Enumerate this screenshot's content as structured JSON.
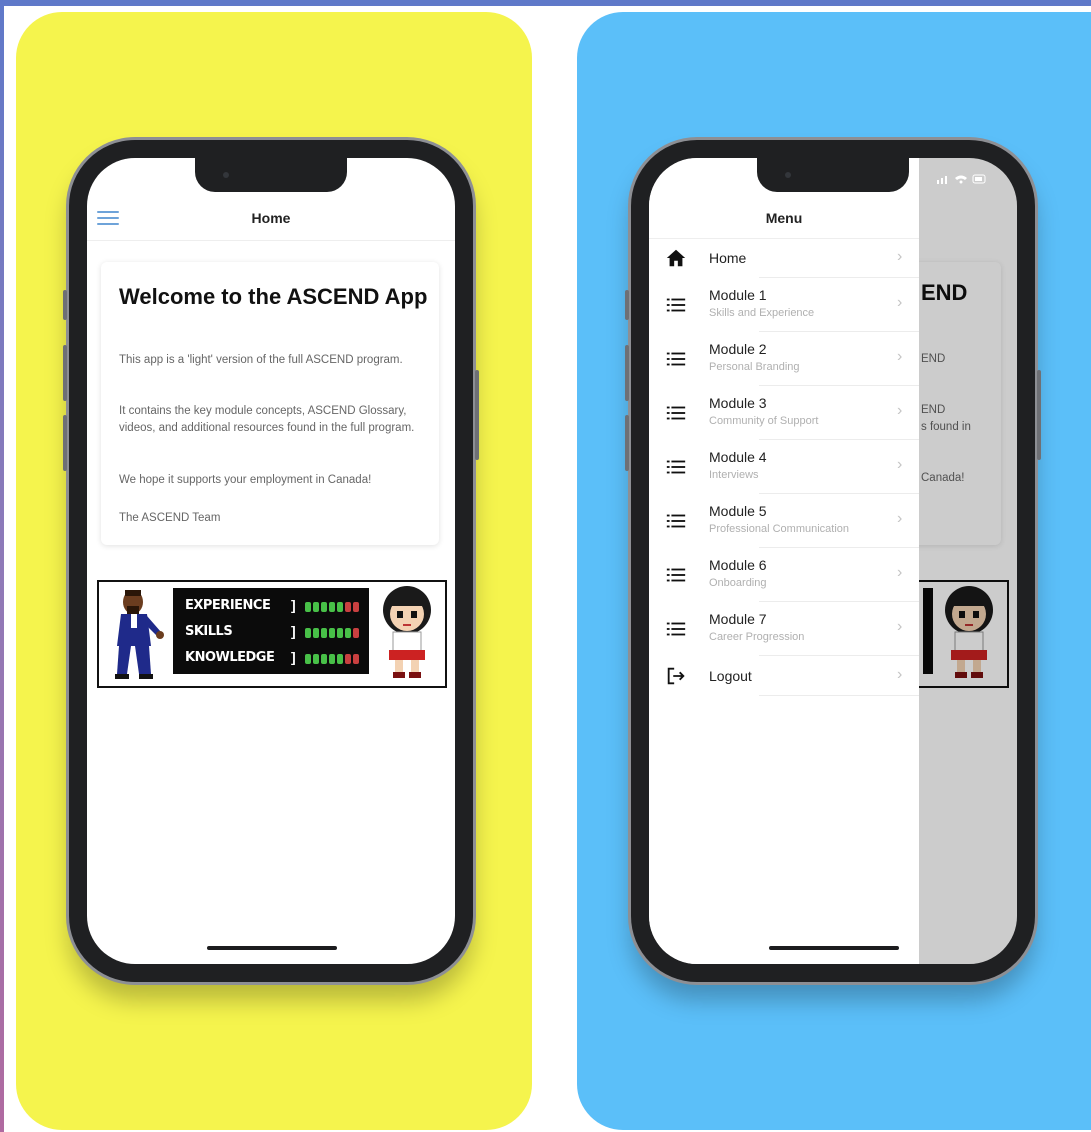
{
  "home_screen": {
    "nav_title": "Home",
    "card": {
      "title": "Welcome to the ASCEND App",
      "paragraphs": [
        "This app is a 'light' version of the full ASCEND program.",
        "It contains the key module concepts, ASCEND Glossary, videos, and additional resources found in the full program.",
        "We hope it supports your employment in Canada!",
        "The ASCEND Team"
      ]
    },
    "banner": {
      "stats": [
        {
          "label": "EXPERIENCE",
          "filled": 5,
          "total": 7
        },
        {
          "label": "SKILLS",
          "filled": 6,
          "total": 7
        },
        {
          "label": "KNOWLEDGE",
          "filled": 5,
          "total": 7
        }
      ]
    }
  },
  "menu_screen": {
    "menu_title": "Menu",
    "items": [
      {
        "label": "Home",
        "subtitle": "",
        "icon": "home-icon"
      },
      {
        "label": "Module 1",
        "subtitle": "Skills and Experience",
        "icon": "list-icon"
      },
      {
        "label": "Module 2",
        "subtitle": "Personal Branding",
        "icon": "list-icon"
      },
      {
        "label": "Module 3",
        "subtitle": "Community of Support",
        "icon": "list-icon"
      },
      {
        "label": "Module 4",
        "subtitle": "Interviews",
        "icon": "list-icon"
      },
      {
        "label": "Module 5",
        "subtitle": "Professional Communication",
        "icon": "list-icon"
      },
      {
        "label": "Module 6",
        "subtitle": "Onboarding",
        "icon": "list-icon"
      },
      {
        "label": "Module 7",
        "subtitle": "Career Progression",
        "icon": "list-icon"
      },
      {
        "label": "Logout",
        "subtitle": "",
        "icon": "logout-icon"
      }
    ],
    "background_fragments": [
      "END",
      "END",
      "END",
      "s found in",
      "Canada!"
    ]
  },
  "colors": {
    "left_panel": "#f5f44d",
    "right_panel": "#5bbff9",
    "hamburger": "#6ea3d9",
    "pip_on": "#48c048",
    "pip_off": "#c94040"
  }
}
